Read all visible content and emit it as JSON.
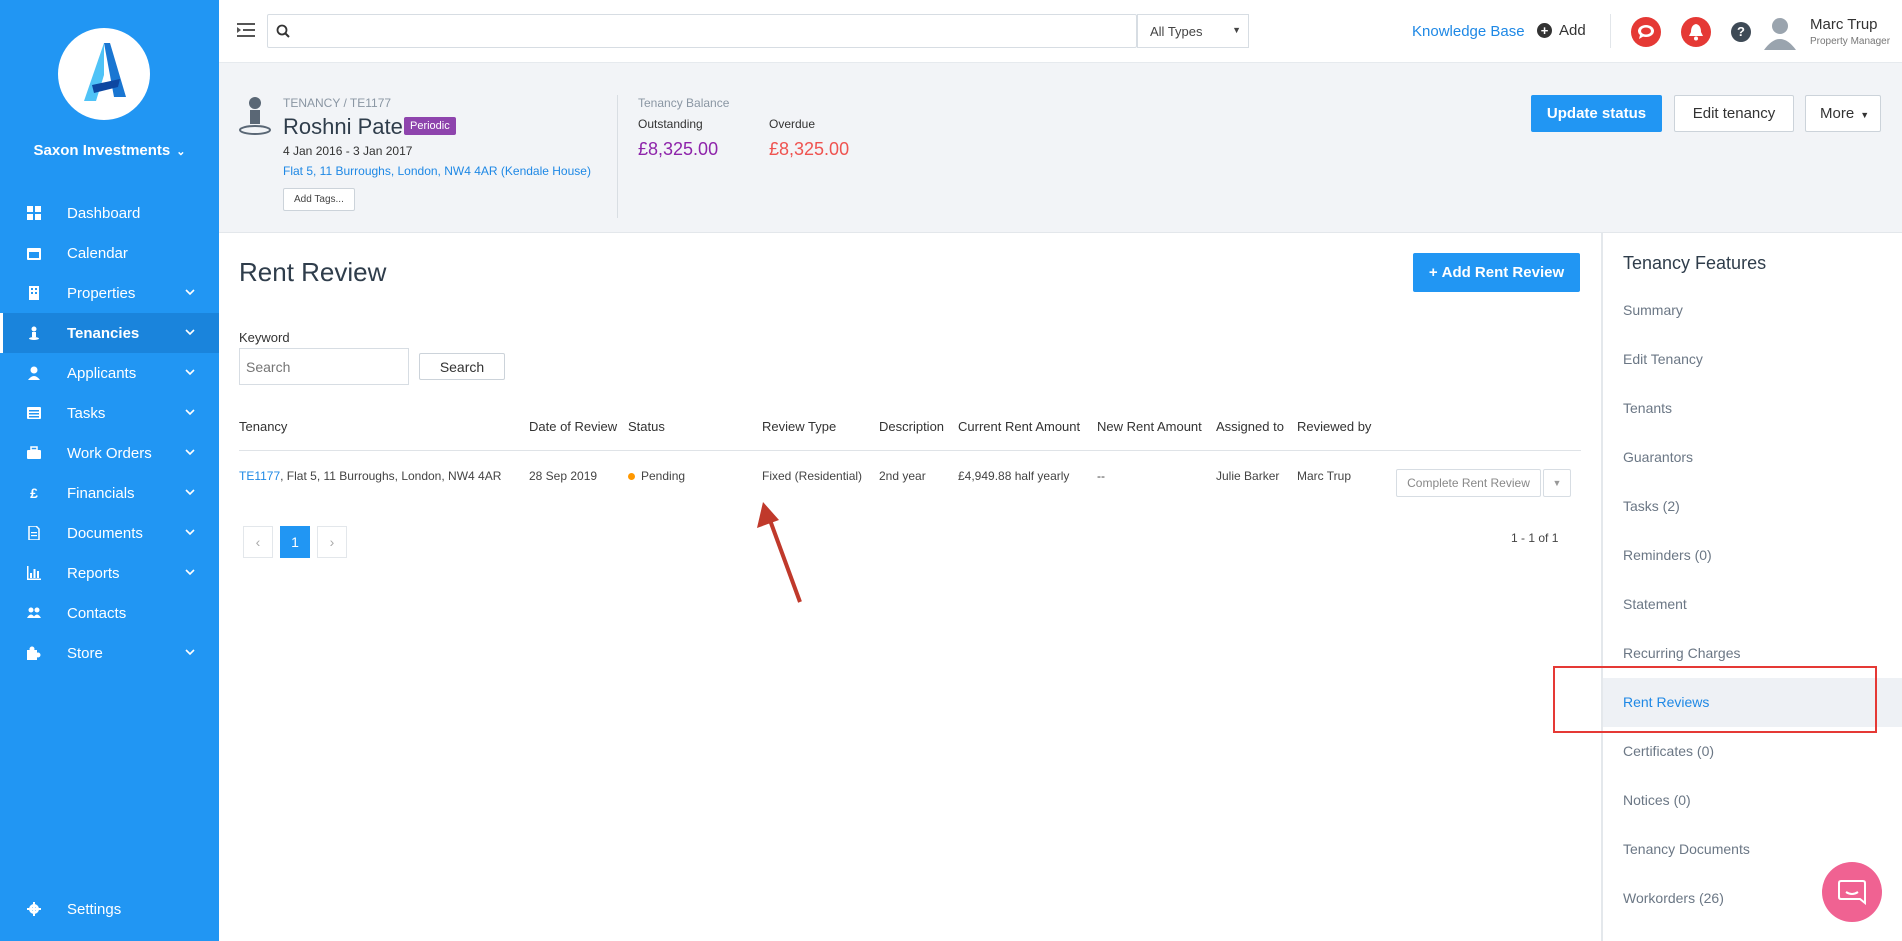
{
  "sidebar": {
    "company": "Saxon Investments",
    "items": [
      {
        "label": "Dashboard",
        "icon": "dashboard-icon",
        "expand": false
      },
      {
        "label": "Calendar",
        "icon": "calendar-icon",
        "expand": false
      },
      {
        "label": "Properties",
        "icon": "properties-icon",
        "expand": true
      },
      {
        "label": "Tenancies",
        "icon": "tenancies-icon",
        "expand": true,
        "active": true
      },
      {
        "label": "Applicants",
        "icon": "applicants-icon",
        "expand": true
      },
      {
        "label": "Tasks",
        "icon": "tasks-icon",
        "expand": true
      },
      {
        "label": "Work Orders",
        "icon": "briefcase-icon",
        "expand": true
      },
      {
        "label": "Financials",
        "icon": "pound-icon",
        "expand": true
      },
      {
        "label": "Documents",
        "icon": "document-icon",
        "expand": true
      },
      {
        "label": "Reports",
        "icon": "chart-icon",
        "expand": true
      },
      {
        "label": "Contacts",
        "icon": "contacts-icon",
        "expand": false
      },
      {
        "label": "Store",
        "icon": "puzzle-icon",
        "expand": true
      }
    ],
    "settings": "Settings"
  },
  "topbar": {
    "search_placeholder": "",
    "type_select": "All Types",
    "knowledge_base": "Knowledge Base",
    "add": "Add",
    "user_name": "Marc Trup",
    "user_role": "Property Manager"
  },
  "tenancy": {
    "breadcrumb": "TENANCY / TE1177",
    "name": "Roshni Patel",
    "badge": "Periodic",
    "dates": "4 Jan 2016 - 3 Jan 2017",
    "address": "Flat 5, 11 Burroughs, London, NW4 4AR (Kendale House)",
    "add_tags": "Add Tags...",
    "balance_title": "Tenancy Balance",
    "outstanding_label": "Outstanding",
    "outstanding_value": "£8,325.00",
    "overdue_label": "Overdue",
    "overdue_value": "£8,325.00",
    "update_status": "Update status",
    "edit_tenancy": "Edit tenancy",
    "more": "More"
  },
  "main": {
    "title": "Rent Review",
    "add_button": "Add Rent Review",
    "keyword_label": "Keyword",
    "keyword_placeholder": "Search",
    "search_button": "Search",
    "columns": [
      "Tenancy",
      "Date of Review",
      "Status",
      "Review Type",
      "Description",
      "Current Rent Amount",
      "New Rent Amount",
      "Assigned to",
      "Reviewed by"
    ],
    "row": {
      "tenancy_ref": "TE1177",
      "tenancy_address": ", Flat 5, 11 Burroughs, London, NW4 4AR",
      "date": "28 Sep 2019",
      "status": "Pending",
      "review_type": "Fixed (Residential)",
      "description": "2nd year",
      "current_rent": "£4,949.88 half yearly",
      "new_rent": "--",
      "assigned_to": "Julie Barker",
      "reviewed_by": "Marc Trup",
      "action": "Complete Rent Review"
    },
    "page": "1",
    "page_info": "1 - 1 of 1"
  },
  "features": {
    "title": "Tenancy Features",
    "items": [
      "Summary",
      "Edit Tenancy",
      "Tenants",
      "Guarantors",
      "Tasks (2)",
      "Reminders (0)",
      "Statement",
      "Recurring Charges",
      "Rent Reviews",
      "Certificates (0)",
      "Notices (0)",
      "Tenancy Documents",
      "Workorders (26)"
    ],
    "active_index": 8
  },
  "colors": {
    "brand": "#2196f3",
    "outstanding": "#8e24aa",
    "overdue": "#ef5350",
    "badge": "#8e44ad",
    "annotation": "#c0392b"
  }
}
